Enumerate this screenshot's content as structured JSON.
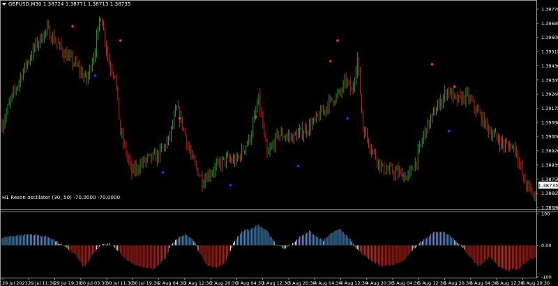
{
  "main": {
    "title": "GBPUSD,M30  1.38724 1.38771 1.38713 1.38735",
    "price_axis": [
      "1.39770",
      "1.39685",
      "1.39600",
      "1.39515",
      "1.39430",
      "1.39345",
      "1.39260",
      "1.39175",
      "1.39090",
      "1.39000",
      "1.38920",
      "1.38835",
      "1.38750",
      "1.38665",
      "1.38580"
    ],
    "current_price": "1.38735"
  },
  "oscillator": {
    "title": "H1 Reson oscillator (30, 50) -70.0000 -70.0000",
    "axis": [
      "100",
      "0.00",
      "-100"
    ]
  },
  "time_axis": [
    "29 Jul 2021",
    "29 Jul 11:30",
    "29 Jul 19:30",
    "30 Jul 03:30",
    "30 Jul 11:30",
    "30 Jul 19:30",
    "2 Aug 04:30",
    "2 Aug 12:30",
    "2 Aug 20:30",
    "3 Aug 04:30",
    "3 Aug 12:30",
    "3 Aug 20:30",
    "4 Aug 04:30",
    "4 Aug 12:30",
    "4 Aug 20:30",
    "5 Aug 04:30",
    "5 Aug 12:30",
    "5 Aug 20:30",
    "6 Aug 04:30",
    "6 Aug 12:30",
    "6 Aug 20:30"
  ],
  "colors": {
    "background": "#000000",
    "bull": "#1fa31f",
    "bear": "#e01b1b",
    "dot_up": "#ff2a2a",
    "dot_down": "#1a37ff",
    "osc_blue": "#4f97d8",
    "osc_white": "#e8e8e8",
    "osc_red": "#c8261d",
    "axis_text": "#ffffff"
  },
  "chart_data": {
    "type": "candlestick",
    "symbol": "GBPUSD",
    "timeframe": "M30",
    "ylim": [
      1.3858,
      1.3985
    ],
    "y_anchors": [
      [
        0,
        1.391
      ],
      [
        6,
        1.3925
      ],
      [
        16,
        1.3946
      ],
      [
        24,
        1.396
      ],
      [
        32,
        1.397
      ],
      [
        44,
        1.3955
      ],
      [
        52,
        1.3948
      ],
      [
        60,
        1.3938
      ],
      [
        66,
        1.3958
      ],
      [
        70,
        1.398
      ],
      [
        76,
        1.3948
      ],
      [
        80,
        1.3942
      ],
      [
        84,
        1.3905
      ],
      [
        92,
        1.388
      ],
      [
        102,
        1.3888
      ],
      [
        110,
        1.389
      ],
      [
        118,
        1.39
      ],
      [
        124,
        1.392
      ],
      [
        128,
        1.391
      ],
      [
        134,
        1.389
      ],
      [
        142,
        1.3875
      ],
      [
        150,
        1.3882
      ],
      [
        158,
        1.3888
      ],
      [
        166,
        1.3887
      ],
      [
        176,
        1.3902
      ],
      [
        182,
        1.3926
      ],
      [
        188,
        1.389
      ],
      [
        196,
        1.3904
      ],
      [
        206,
        1.3902
      ],
      [
        214,
        1.3906
      ],
      [
        222,
        1.3912
      ],
      [
        232,
        1.3924
      ],
      [
        240,
        1.393
      ],
      [
        244,
        1.3938
      ],
      [
        248,
        1.393
      ],
      [
        252,
        1.3952
      ],
      [
        256,
        1.3908
      ],
      [
        262,
        1.3895
      ],
      [
        270,
        1.3882
      ],
      [
        280,
        1.388
      ],
      [
        288,
        1.3877
      ],
      [
        294,
        1.3888
      ],
      [
        300,
        1.3906
      ],
      [
        308,
        1.392
      ],
      [
        316,
        1.3932
      ],
      [
        322,
        1.3925
      ],
      [
        330,
        1.3928
      ],
      [
        338,
        1.3917
      ],
      [
        346,
        1.3906
      ],
      [
        356,
        1.3897
      ],
      [
        364,
        1.3896
      ],
      [
        370,
        1.3875
      ],
      [
        378,
        1.3864
      ]
    ],
    "n_candles": 379,
    "dots_up": [
      [
        50,
        1.3972
      ],
      [
        84,
        1.3963
      ],
      [
        126,
        1.3914
      ],
      [
        180,
        1.3915
      ],
      [
        233,
        1.395
      ],
      [
        238,
        1.3963
      ],
      [
        305,
        1.3948
      ],
      [
        321,
        1.3934
      ]
    ],
    "dots_down": [
      [
        66,
        1.3941
      ],
      [
        114,
        1.388
      ],
      [
        162,
        1.3872
      ],
      [
        210,
        1.3884
      ],
      [
        245,
        1.3914
      ],
      [
        284,
        1.3878
      ],
      [
        317,
        1.3906
      ]
    ],
    "oscillator": {
      "ylim": [
        -100,
        100
      ],
      "anchors": [
        [
          0,
          25
        ],
        [
          8,
          30
        ],
        [
          20,
          35
        ],
        [
          28,
          30
        ],
        [
          34,
          25
        ],
        [
          40,
          8
        ],
        [
          46,
          -10
        ],
        [
          52,
          -30
        ],
        [
          58,
          -70
        ],
        [
          62,
          -45
        ],
        [
          66,
          -20
        ],
        [
          70,
          0
        ],
        [
          76,
          5
        ],
        [
          82,
          -15
        ],
        [
          88,
          -45
        ],
        [
          94,
          -60
        ],
        [
          100,
          -70
        ],
        [
          108,
          -75
        ],
        [
          116,
          -40
        ],
        [
          120,
          0
        ],
        [
          124,
          20
        ],
        [
          130,
          35
        ],
        [
          136,
          15
        ],
        [
          140,
          -25
        ],
        [
          146,
          -65
        ],
        [
          152,
          -70
        ],
        [
          158,
          -55
        ],
        [
          164,
          5
        ],
        [
          170,
          45
        ],
        [
          176,
          50
        ],
        [
          182,
          65
        ],
        [
          188,
          45
        ],
        [
          194,
          5
        ],
        [
          200,
          -10
        ],
        [
          206,
          5
        ],
        [
          212,
          30
        ],
        [
          218,
          45
        ],
        [
          222,
          30
        ],
        [
          228,
          15
        ],
        [
          234,
          40
        ],
        [
          240,
          50
        ],
        [
          246,
          25
        ],
        [
          250,
          -5
        ],
        [
          256,
          -30
        ],
        [
          262,
          -50
        ],
        [
          270,
          -65
        ],
        [
          278,
          -60
        ],
        [
          286,
          -45
        ],
        [
          290,
          -20
        ],
        [
          298,
          15
        ],
        [
          306,
          40
        ],
        [
          312,
          45
        ],
        [
          318,
          30
        ],
        [
          324,
          5
        ],
        [
          330,
          -25
        ],
        [
          338,
          -70
        ],
        [
          346,
          -35
        ],
        [
          352,
          -65
        ],
        [
          358,
          -80
        ],
        [
          366,
          -75
        ],
        [
          374,
          -45
        ],
        [
          378,
          -40
        ]
      ]
    }
  }
}
